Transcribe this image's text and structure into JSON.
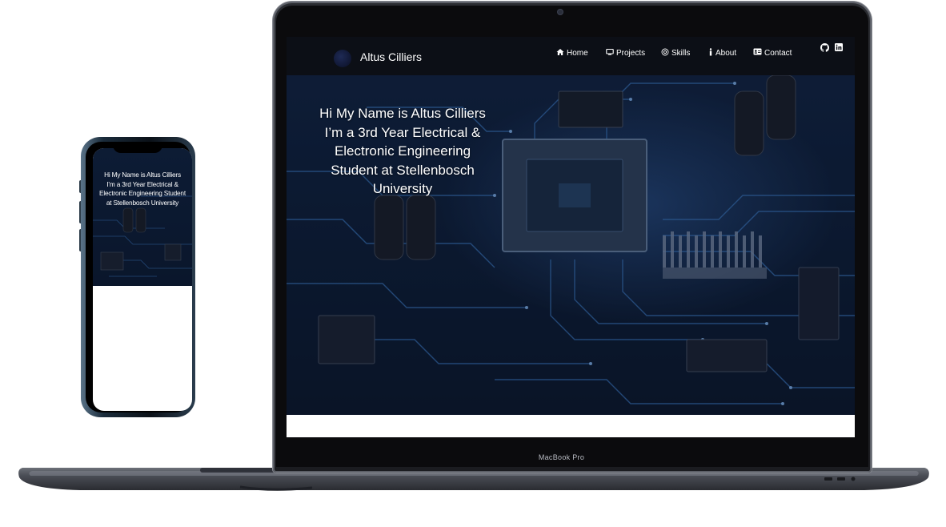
{
  "laptop": {
    "model_label": "MacBook Pro",
    "site": {
      "brand_name": "Altus Cilliers",
      "nav": [
        {
          "label": "Home",
          "icon": "home-icon"
        },
        {
          "label": "Projects",
          "icon": "monitor-icon"
        },
        {
          "label": "Skills",
          "icon": "at-icon"
        },
        {
          "label": "About",
          "icon": "info-icon"
        },
        {
          "label": "Contact",
          "icon": "contact-card-icon"
        }
      ],
      "social_icons": [
        "github-icon",
        "linkedin-icon"
      ],
      "hero_text": "Hi My Name is Altus Cilliers I’m a 3rd Year Electrical & Electronic Engineering Student at Stellenbosch University"
    }
  },
  "phone": {
    "hero_text": "Hi My Name is Altus Cilliers I’m a 3rd Year Electrical & Electronic Engineering Student at Stellenbosch University"
  },
  "colors": {
    "nav_background": "#0c0f16",
    "hero_dark": "#0d1d35",
    "accent_blue": "#4a90d9"
  }
}
